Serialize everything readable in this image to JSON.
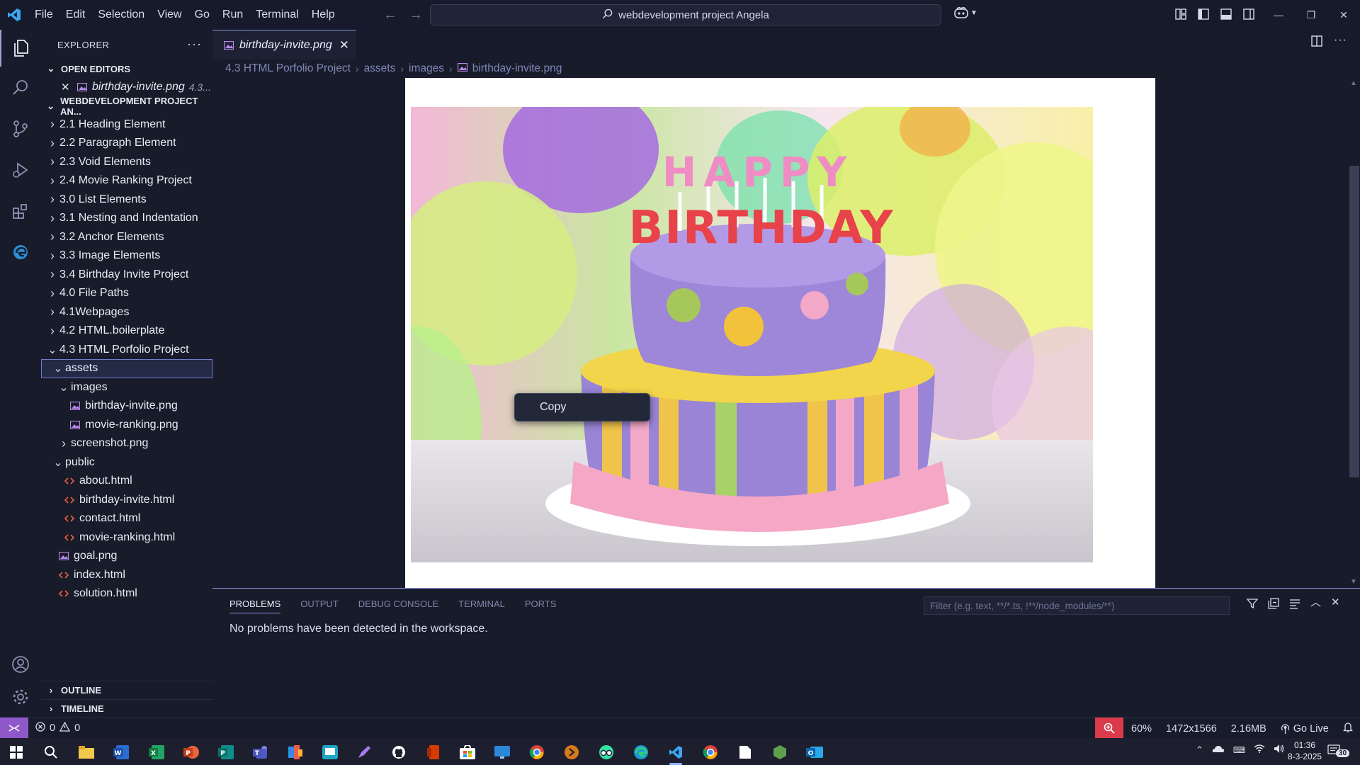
{
  "menu": [
    "File",
    "Edit",
    "Selection",
    "View",
    "Go",
    "Run",
    "Terminal",
    "Help"
  ],
  "search": {
    "text": "webdevelopment project Angela"
  },
  "sidebar": {
    "title": "EXPLORER",
    "open_editors_label": "OPEN EDITORS",
    "open_editor": {
      "name": "birthday-invite.png",
      "extra": "4.3..."
    },
    "project_label": "WEBDEVELOPMENT PROJECT AN...",
    "tree": [
      {
        "label": "2.1 Heading Element",
        "depth": 0,
        "type": "folder",
        "expanded": false
      },
      {
        "label": "2.2 Paragraph Element",
        "depth": 0,
        "type": "folder",
        "expanded": false
      },
      {
        "label": "2.3 Void Elements",
        "depth": 0,
        "type": "folder",
        "expanded": false
      },
      {
        "label": "2.4 Movie Ranking Project",
        "depth": 0,
        "type": "folder",
        "expanded": false
      },
      {
        "label": "3.0 List Elements",
        "depth": 0,
        "type": "folder",
        "expanded": false
      },
      {
        "label": "3.1 Nesting and Indentation",
        "depth": 0,
        "type": "folder",
        "expanded": false
      },
      {
        "label": "3.2 Anchor Elements",
        "depth": 0,
        "type": "folder",
        "expanded": false
      },
      {
        "label": "3.3 Image Elements",
        "depth": 0,
        "type": "folder",
        "expanded": false
      },
      {
        "label": "3.4 Birthday Invite Project",
        "depth": 0,
        "type": "folder",
        "expanded": false
      },
      {
        "label": "4.0 File Paths",
        "depth": 0,
        "type": "folder",
        "expanded": false
      },
      {
        "label": "4.1Webpages",
        "depth": 0,
        "type": "folder",
        "expanded": false
      },
      {
        "label": "4.2 HTML.boilerplate",
        "depth": 0,
        "type": "folder",
        "expanded": false
      },
      {
        "label": "4.3 HTML Porfolio Project",
        "depth": 0,
        "type": "folder",
        "expanded": true
      },
      {
        "label": "assets",
        "depth": 1,
        "type": "folder",
        "expanded": true,
        "selected": true
      },
      {
        "label": "images",
        "depth": 2,
        "type": "folder",
        "expanded": true
      },
      {
        "label": "birthday-invite.png",
        "depth": 3,
        "type": "image"
      },
      {
        "label": "movie-ranking.png",
        "depth": 3,
        "type": "image"
      },
      {
        "label": "screenshot.png",
        "depth": 2,
        "type": "folder",
        "expanded": false
      },
      {
        "label": "public",
        "depth": 1,
        "type": "folder",
        "expanded": true
      },
      {
        "label": "about.html",
        "depth": 2,
        "type": "html"
      },
      {
        "label": "birthday-invite.html",
        "depth": 2,
        "type": "html"
      },
      {
        "label": "contact.html",
        "depth": 2,
        "type": "html"
      },
      {
        "label": "movie-ranking.html",
        "depth": 2,
        "type": "html"
      },
      {
        "label": "goal.png",
        "depth": 1,
        "type": "image"
      },
      {
        "label": "index.html",
        "depth": 1,
        "type": "html"
      },
      {
        "label": "solution.html",
        "depth": 1,
        "type": "html"
      }
    ],
    "outline_label": "OUTLINE",
    "timeline_label": "TIMELINE"
  },
  "editor": {
    "tab_label": "birthday-invite.png",
    "breadcrumb": [
      "4.3 HTML Porfolio Project",
      "assets",
      "images",
      "birthday-invite.png"
    ],
    "image_text_line1": "HAPPY",
    "image_text_line2": "BIRTHDAY",
    "context_menu_item": "Copy"
  },
  "panel": {
    "tabs": [
      "PROBLEMS",
      "OUTPUT",
      "DEBUG CONSOLE",
      "TERMINAL",
      "PORTS"
    ],
    "active_tab": "PROBLEMS",
    "filter_placeholder": "Filter (e.g. text, **/*.ts, !**/node_modules/**)",
    "message": "No problems have been detected in the workspace."
  },
  "statusbar": {
    "errors": "0",
    "warnings": "0",
    "zoom": "60%",
    "dimensions": "1472x1566",
    "size": "2.16MB",
    "go_live": "Go Live"
  },
  "taskbar": {
    "time": "01:36",
    "date": "8-3-2025",
    "notification_count": "30"
  },
  "colors": {
    "accent": "#8a95e0",
    "remote_indicator": "#8e58c9",
    "zoom_badge": "#d93b4b",
    "background": "#181b2a"
  }
}
